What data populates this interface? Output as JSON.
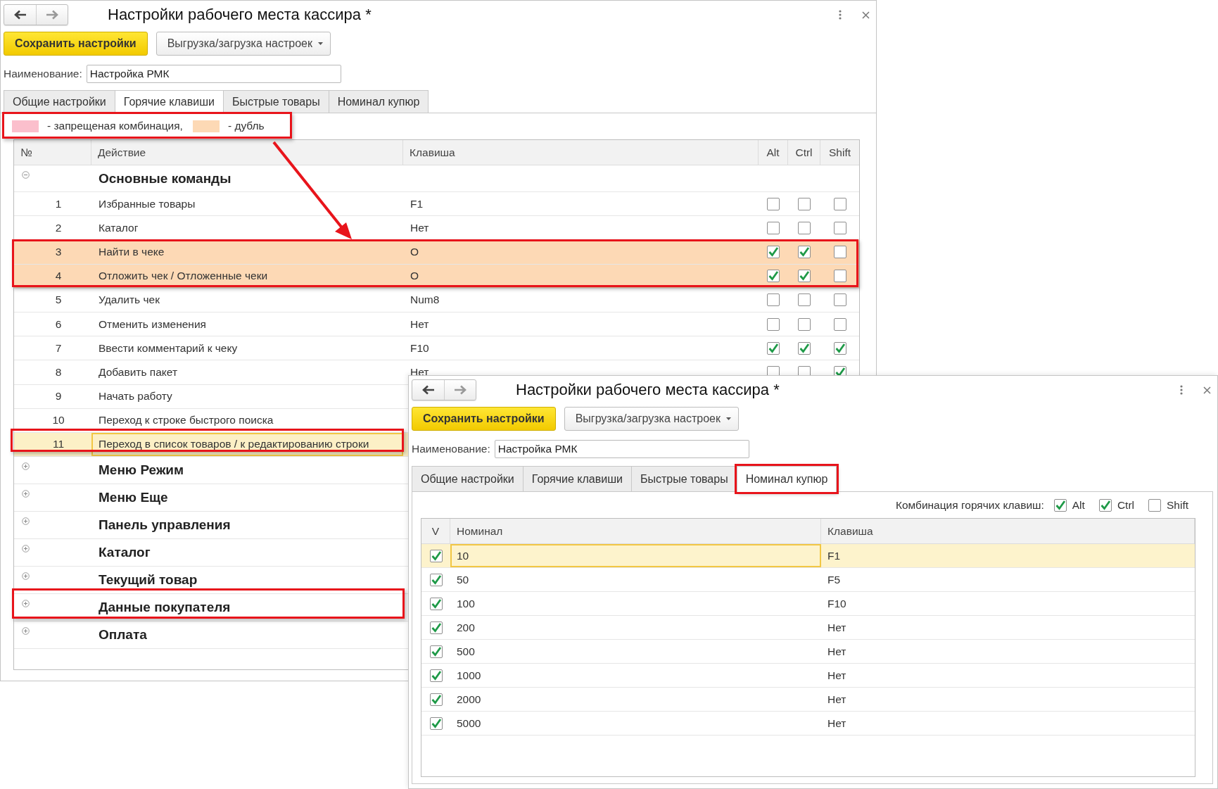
{
  "hotkeys_window": {
    "title": "Настройки рабочего места кассира *",
    "save_button": "Сохранить настройки",
    "export_button": "Выгрузка/загрузка настроек",
    "name_field": {
      "label": "Наименование:",
      "value": "Настройка РМК"
    },
    "tabs": [
      {
        "label": "Общие настройки",
        "selected": false
      },
      {
        "label": "Горячие клавиши",
        "selected": true
      },
      {
        "label": "Быстрые товары",
        "selected": false
      },
      {
        "label": "Номинал купюр",
        "selected": false
      }
    ],
    "legend": [
      {
        "label": "- запрещеная комбинация,",
        "color": "#fbbfcc"
      },
      {
        "label": "- дубль",
        "color": "#fdd9b5"
      }
    ],
    "table": {
      "columns": [
        "№",
        "Действие",
        "Клавиша",
        "Alt",
        "Ctrl",
        "Shift"
      ],
      "groups": [
        {
          "title": "Основные команды",
          "expanded": true,
          "children": [
            {
              "number": "1",
              "action": "Избранные товары",
              "key": "F1",
              "alt": false,
              "ctrl": false,
              "shift": false,
              "duplicate": false,
              "selected": false
            },
            {
              "number": "2",
              "action": "Каталог",
              "key": "Нет",
              "alt": false,
              "ctrl": false,
              "shift": false,
              "duplicate": false,
              "selected": false
            },
            {
              "number": "3",
              "action": "Найти в чеке",
              "key": "O",
              "alt": true,
              "ctrl": true,
              "shift": false,
              "duplicate": true,
              "selected": false
            },
            {
              "number": "4",
              "action": "Отложить чек / Отложенные чеки",
              "key": "O",
              "alt": true,
              "ctrl": true,
              "shift": false,
              "duplicate": true,
              "selected": false
            },
            {
              "number": "5",
              "action": "Удалить чек",
              "key": "Num8",
              "alt": false,
              "ctrl": false,
              "shift": false,
              "duplicate": false,
              "selected": false
            },
            {
              "number": "6",
              "action": "Отменить изменения",
              "key": "Нет",
              "alt": false,
              "ctrl": false,
              "shift": false,
              "duplicate": false,
              "selected": false
            },
            {
              "number": "7",
              "action": "Ввести комментарий к чеку",
              "key": "F10",
              "alt": true,
              "ctrl": true,
              "shift": true,
              "duplicate": false,
              "selected": false
            },
            {
              "number": "8",
              "action": "Добавить пакет",
              "key": "Нет",
              "alt": false,
              "ctrl": false,
              "shift": true,
              "duplicate": false,
              "selected": false
            },
            {
              "number": "9",
              "action": "Начать работу",
              "duplicate": false,
              "selected": false
            },
            {
              "number": "10",
              "action": "Переход к строке быстрого поиска",
              "duplicate": false,
              "selected": false
            },
            {
              "number": "11",
              "action": "Переход в список товаров / к редактированию строки",
              "selected": true
            }
          ]
        },
        {
          "title": "Меню Режим",
          "expanded": false
        },
        {
          "title": "Меню Еще",
          "expanded": false
        },
        {
          "title": "Панель управления",
          "expanded": false
        },
        {
          "title": "Каталог",
          "expanded": false
        },
        {
          "title": "Текущий товар",
          "expanded": false
        },
        {
          "title": "Данные покупателя",
          "expanded": false
        },
        {
          "title": "Оплата",
          "expanded": false
        }
      ]
    }
  },
  "denominations_window": {
    "title": "Настройки рабочего места кассира *",
    "save_button": "Сохранить настройки",
    "export_button": "Выгрузка/загрузка настроек",
    "name_field": {
      "label": "Наименование:",
      "value": "Настройка РМК"
    },
    "tabs": [
      {
        "label": "Общие настройки",
        "selected": false
      },
      {
        "label": "Горячие клавиши",
        "selected": false
      },
      {
        "label": "Быстрые товары",
        "selected": false
      },
      {
        "label": "Номинал купюр",
        "selected": true
      }
    ],
    "hotkey_combination": {
      "label": "Комбинация горячих клавиш:",
      "options": [
        {
          "label": "Alt",
          "checked": true
        },
        {
          "label": "Ctrl",
          "checked": true
        },
        {
          "label": "Shift",
          "checked": false
        }
      ]
    },
    "table": {
      "columns": [
        "V",
        "Номинал",
        "Клавиша"
      ],
      "rows": [
        {
          "checked": true,
          "value": "10",
          "key": "F1",
          "selected": true
        },
        {
          "checked": true,
          "value": "50",
          "key": "F5",
          "selected": false
        },
        {
          "checked": true,
          "value": "100",
          "key": "F10",
          "selected": false
        },
        {
          "checked": true,
          "value": "200",
          "key": "Нет",
          "selected": false
        },
        {
          "checked": true,
          "value": "500",
          "key": "Нет",
          "selected": false
        },
        {
          "checked": true,
          "value": "1000",
          "key": "Нет",
          "selected": false
        },
        {
          "checked": true,
          "value": "2000",
          "key": "Нет",
          "selected": false
        },
        {
          "checked": true,
          "value": "5000",
          "key": "Нет",
          "selected": false
        }
      ]
    }
  }
}
